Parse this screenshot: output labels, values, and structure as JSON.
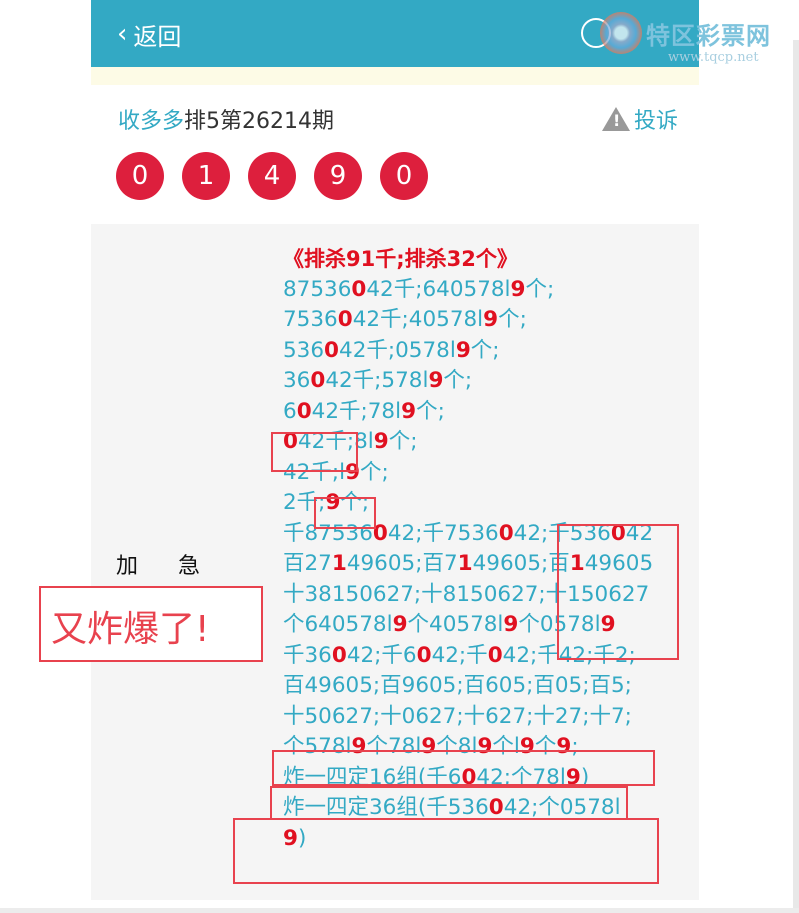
{
  "header": {
    "back_label": "返回",
    "back_icon": "chevron-left-icon",
    "search_icon": "search-icon"
  },
  "watermark": {
    "name": "特区彩票网",
    "url": "www.tqcp.net"
  },
  "title": {
    "nickname": "收多多",
    "text": "排5第26214期",
    "complain_label": "投诉"
  },
  "balls": [
    "0",
    "1",
    "4",
    "9",
    "0"
  ],
  "panel": {
    "label": "加急",
    "headline": "《排杀91千;排杀32个》",
    "lines": [
      [
        [
          "87536",
          ""
        ],
        [
          "0",
          "r"
        ],
        [
          "42千;640578l",
          ""
        ],
        [
          "9",
          "r"
        ],
        [
          "个;",
          ""
        ]
      ],
      [
        [
          "7536",
          ""
        ],
        [
          "0",
          "r"
        ],
        [
          "42千;40578l",
          ""
        ],
        [
          "9",
          "r"
        ],
        [
          "个;",
          ""
        ]
      ],
      [
        [
          "536",
          ""
        ],
        [
          "0",
          "r"
        ],
        [
          "42千;0578l",
          ""
        ],
        [
          "9",
          "r"
        ],
        [
          "个;",
          ""
        ]
      ],
      [
        [
          "36",
          ""
        ],
        [
          "0",
          "r"
        ],
        [
          "42千;578l",
          ""
        ],
        [
          "9",
          "r"
        ],
        [
          "个;",
          ""
        ]
      ],
      [
        [
          "6",
          ""
        ],
        [
          "0",
          "r"
        ],
        [
          "42千;78l",
          ""
        ],
        [
          "9",
          "r"
        ],
        [
          "个;",
          ""
        ]
      ],
      [
        [
          "0",
          "r"
        ],
        [
          "42千;8l",
          ""
        ],
        [
          "9",
          "r"
        ],
        [
          "个;",
          ""
        ]
      ],
      [
        [
          "42千;l",
          ""
        ],
        [
          "9",
          "r"
        ],
        [
          "个;",
          ""
        ]
      ],
      [
        [
          "2千;",
          ""
        ],
        [
          "9",
          "r"
        ],
        [
          "个;",
          ""
        ]
      ],
      [
        [
          "千87536",
          ""
        ],
        [
          "0",
          "r"
        ],
        [
          "42;千7536",
          ""
        ],
        [
          "0",
          "r"
        ],
        [
          "42;千536",
          ""
        ],
        [
          "0",
          "r"
        ],
        [
          "42",
          ""
        ]
      ],
      [
        [
          "百27",
          ""
        ],
        [
          "1",
          "r"
        ],
        [
          "49605;百7",
          ""
        ],
        [
          "1",
          "r"
        ],
        [
          "49605;百",
          ""
        ],
        [
          "1",
          "r"
        ],
        [
          "49605",
          ""
        ]
      ],
      [
        [
          "十38150627;十8150627;十150627",
          ""
        ]
      ],
      [
        [
          "个640578l",
          ""
        ],
        [
          "9",
          "r"
        ],
        [
          "个40578l",
          ""
        ],
        [
          "9",
          "r"
        ],
        [
          "个0578l",
          ""
        ],
        [
          "9",
          "r"
        ]
      ],
      [
        [
          "千36",
          ""
        ],
        [
          "0",
          "r"
        ],
        [
          "42;千6",
          ""
        ],
        [
          "0",
          "r"
        ],
        [
          "42;千",
          ""
        ],
        [
          "0",
          "r"
        ],
        [
          "42;千42;千2;",
          ""
        ]
      ],
      [
        [
          "百49605;百9605;百605;百05;百5;",
          ""
        ]
      ],
      [
        [
          "十50627;十0627;十627;十27;十7;",
          ""
        ]
      ],
      [
        [
          "个578l",
          ""
        ],
        [
          "9",
          "r"
        ],
        [
          "个78l",
          ""
        ],
        [
          "9",
          "r"
        ],
        [
          "个8l",
          ""
        ],
        [
          "9",
          "r"
        ],
        [
          "个l",
          ""
        ],
        [
          "9",
          "r"
        ],
        [
          "个",
          ""
        ],
        [
          "9",
          "r"
        ],
        [
          ";",
          ""
        ]
      ],
      [
        [
          "炸一四定16组(千6",
          ""
        ],
        [
          "0",
          "r"
        ],
        [
          "42;个78l",
          ""
        ],
        [
          "9",
          "r"
        ],
        [
          ")",
          ""
        ]
      ],
      [
        [
          "炸一四定36组(千536",
          ""
        ],
        [
          "0",
          "r"
        ],
        [
          "42;个0578l",
          ""
        ]
      ],
      [
        [
          "9",
          "r"
        ],
        [
          ")",
          ""
        ]
      ]
    ]
  },
  "stamp_text": "又炸爆了!"
}
